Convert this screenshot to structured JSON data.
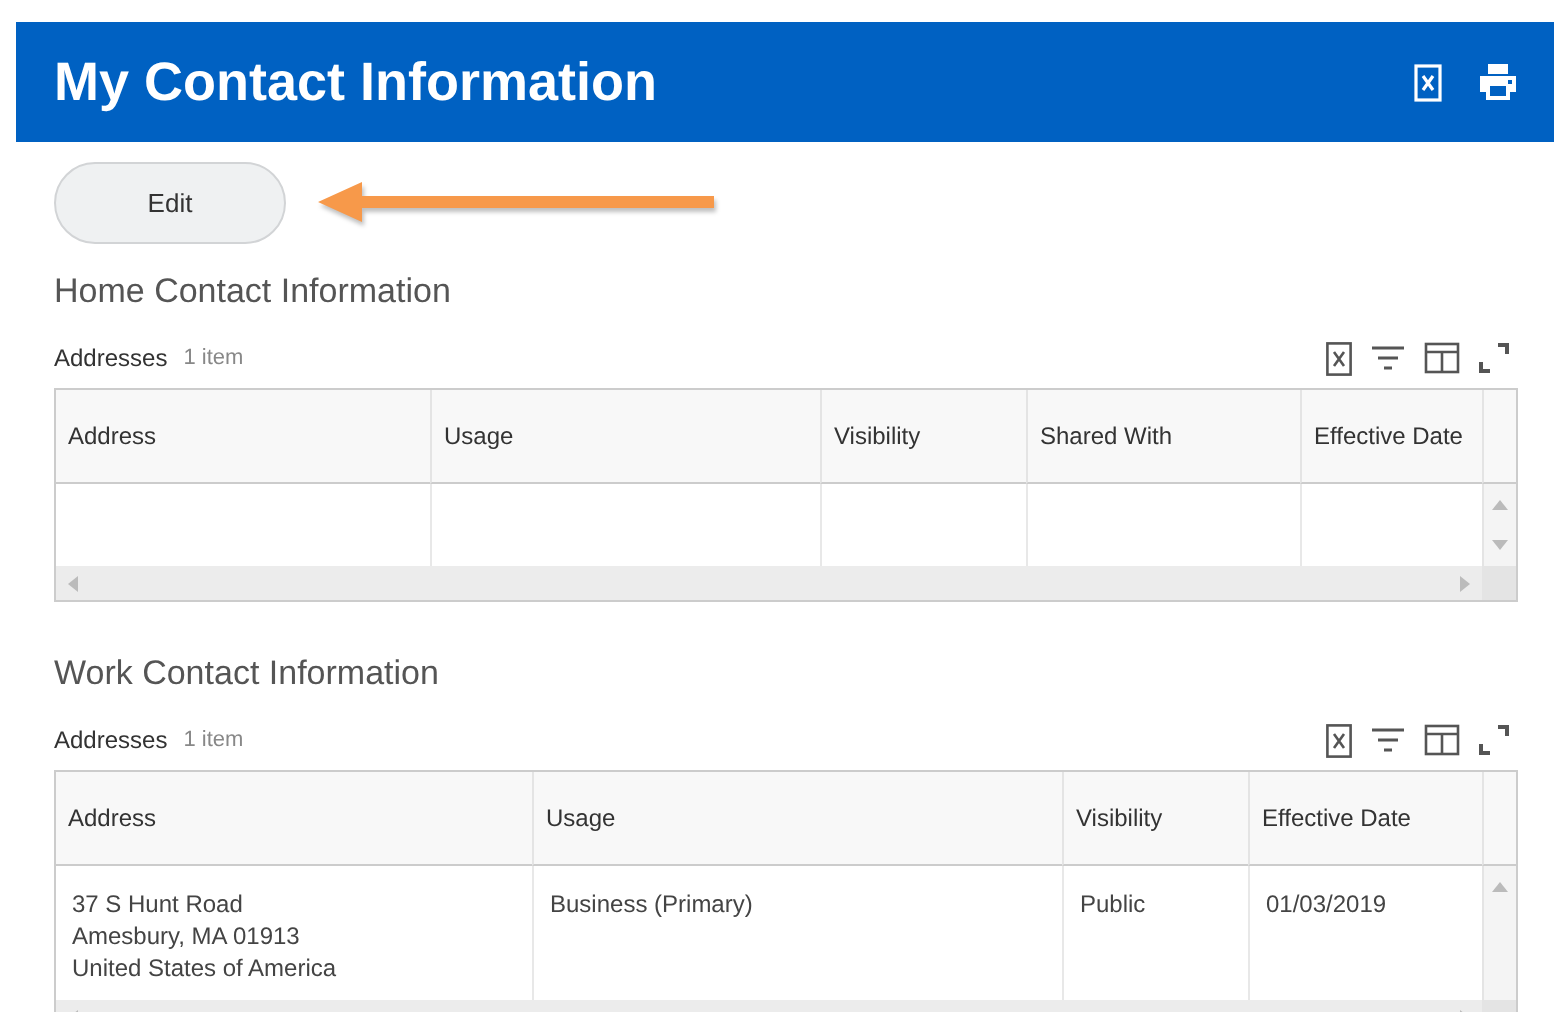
{
  "header": {
    "title": "My Contact Information"
  },
  "edit_button": {
    "label": "Edit"
  },
  "sections": [
    {
      "title": "Home Contact Information",
      "table": {
        "title": "Addresses",
        "count": "1 item",
        "columns": [
          "Address",
          "Usage",
          "Visibility",
          "Shared With",
          "Effective Date"
        ]
      }
    },
    {
      "title": "Work Contact Information",
      "table": {
        "title": "Addresses",
        "count": "1 item",
        "columns": [
          "Address",
          "Usage",
          "Visibility",
          "Effective Date"
        ],
        "rows": [
          {
            "cells": [
              {
                "lines": [
                  "37 S Hunt Road",
                  "Amesbury, MA 01913",
                  "United States of America"
                ]
              },
              {
                "lines": [
                  "Business (Primary)"
                ]
              },
              {
                "lines": [
                  "Public"
                ]
              },
              {
                "lines": [
                  "01/03/2019"
                ]
              }
            ]
          }
        ]
      }
    }
  ]
}
